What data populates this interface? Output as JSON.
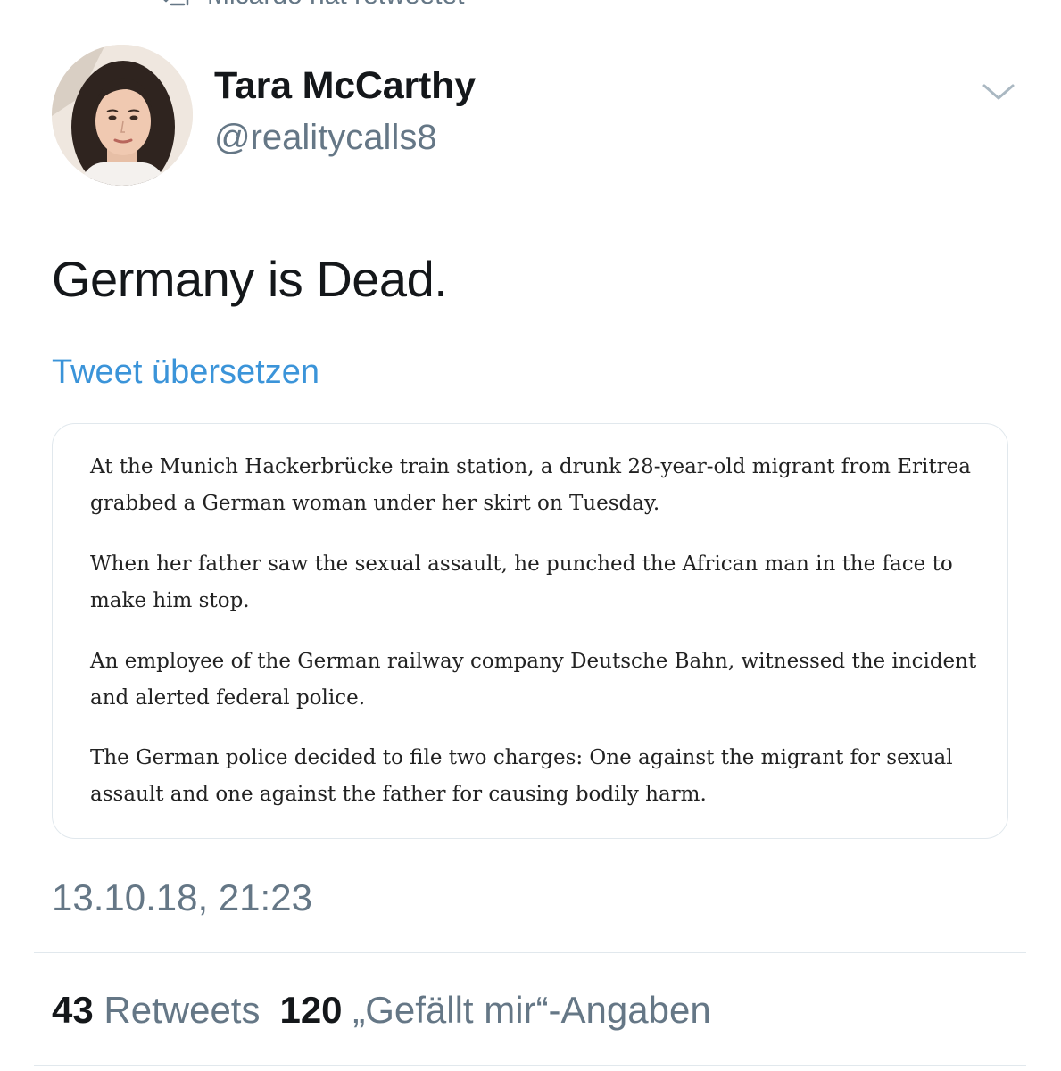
{
  "retweet_context": {
    "text": "Micardo hat retweetet",
    "icon": "retweet-icon"
  },
  "author": {
    "name": "Tara McCarthy",
    "handle": "@realitycalls8",
    "avatar": "profile-photo"
  },
  "tweet": {
    "text": "Germany is Dead.",
    "translate_label": "Tweet übersetzen",
    "menu_icon": "chevron-down-icon"
  },
  "quote_image": {
    "paragraphs": [
      [
        "At the Munich Hackerbrücke train station, a drunk 28-year-old migrant from Eritrea",
        "grabbed a German woman under her skirt on Tuesday."
      ],
      [
        "When her father saw the sexual assault, he punched the African man in the face to",
        "make him stop."
      ],
      [
        "An employee of the German railway company Deutsche Bahn, witnessed the incident",
        "and alerted federal police."
      ],
      [
        "The German police decided to file two charges: One against the migrant for sexual",
        "assault and one against the father for causing bodily harm."
      ]
    ]
  },
  "timestamp": "13.10.18, 21:23",
  "stats": {
    "retweets_count": "43",
    "retweets_label": "Retweets",
    "likes_count": "120",
    "likes_label": "„Gefällt mir“-Angaben"
  },
  "colors": {
    "primary_text": "#14171a",
    "secondary_text": "#657786",
    "link_blue": "#3b94d9",
    "border": "#e1e8ed"
  }
}
